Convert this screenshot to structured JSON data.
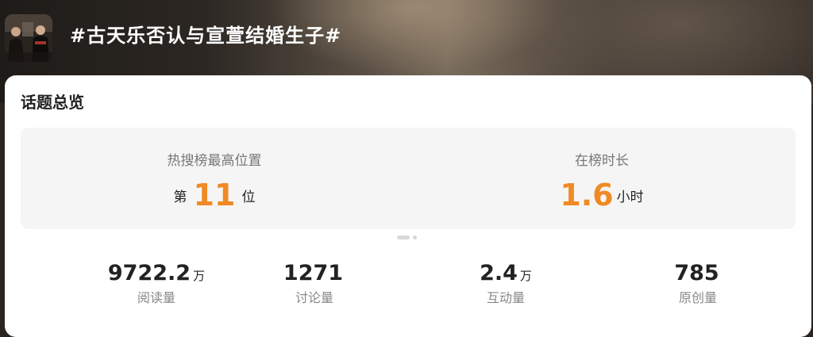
{
  "header": {
    "title": "#古天乐否认与宣萱结婚生子#"
  },
  "overview": {
    "title": "话题总览",
    "ranking": {
      "label": "热搜榜最高位置",
      "prefix": "第",
      "value": "11",
      "suffix": "位"
    },
    "duration": {
      "label": "在榜时长",
      "value": "1.6",
      "unit": "小时"
    },
    "pager": {
      "current": 1,
      "total": 2
    },
    "stats": [
      {
        "value": "9722.2",
        "unit": "万",
        "label": "阅读量"
      },
      {
        "value": "1271",
        "unit": "",
        "label": "讨论量"
      },
      {
        "value": "2.4",
        "unit": "万",
        "label": "互动量"
      },
      {
        "value": "785",
        "unit": "",
        "label": "原创量"
      }
    ]
  },
  "colors": {
    "accent": "#f08a24",
    "card_bg": "#ffffff",
    "panel_bg": "#f5f5f5"
  }
}
